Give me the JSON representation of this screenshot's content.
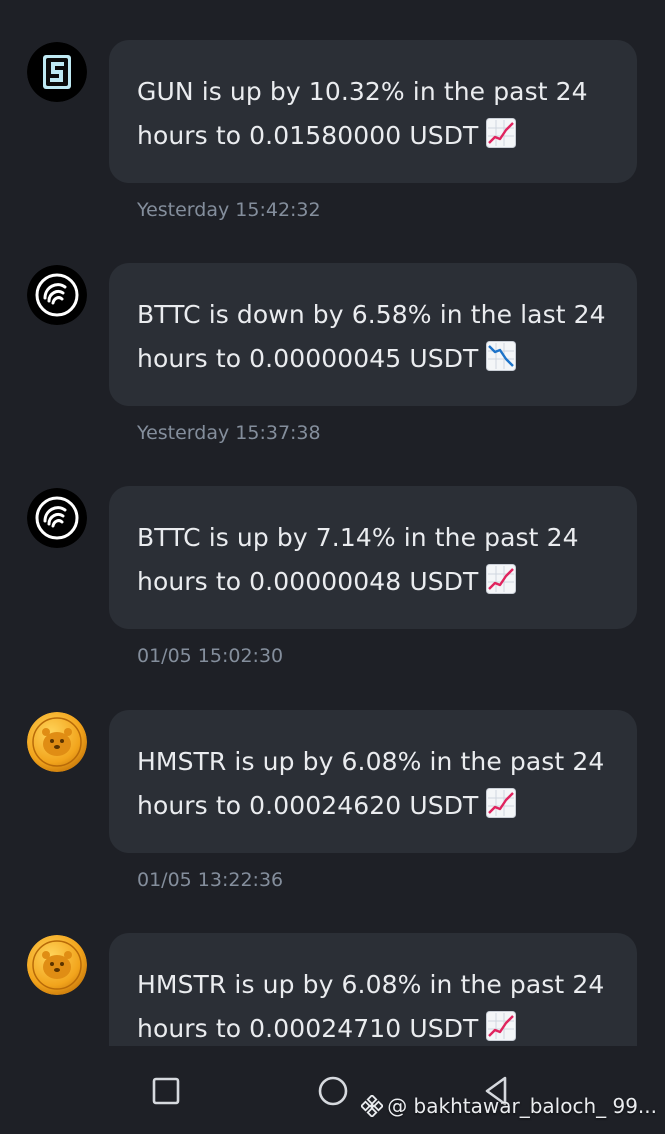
{
  "colors": {
    "background": "#1e2026",
    "bubble": "#2b2f36",
    "text": "#eaecef",
    "timestamp": "#848e9c"
  },
  "messages": [
    {
      "coin": "GUN",
      "avatar_icon": "gun-logo-icon",
      "text": "GUN is up by 10.32% in the past 24 hours to 0.01580000 USDT",
      "trend_icon": "chart-increasing-icon",
      "timestamp": "Yesterday 15:42:32"
    },
    {
      "coin": "BTTC",
      "avatar_icon": "bttc-logo-icon",
      "text": "BTTC is down by 6.58% in the last 24 hours to 0.00000045 USDT",
      "trend_icon": "chart-decreasing-icon",
      "timestamp": "Yesterday 15:37:38"
    },
    {
      "coin": "BTTC",
      "avatar_icon": "bttc-logo-icon",
      "text": "BTTC is up by 7.14% in the past 24 hours to 0.00000048 USDT",
      "trend_icon": "chart-increasing-icon",
      "timestamp": "01/05 15:02:30"
    },
    {
      "coin": "HMSTR",
      "avatar_icon": "hamster-logo-icon",
      "text": "HMSTR is up by 6.08% in the past 24 hours to 0.00024620 USDT",
      "trend_icon": "chart-increasing-icon",
      "timestamp": "01/05 13:22:36"
    },
    {
      "coin": "HMSTR",
      "avatar_icon": "hamster-logo-icon",
      "text": "HMSTR is up by 6.08% in the past 24 hours to 0.00024710 USDT",
      "trend_icon": "chart-increasing-icon",
      "timestamp": ""
    }
  ],
  "navbar": {
    "recents_icon": "square-icon",
    "home_icon": "circle-icon",
    "back_icon": "triangle-back-icon"
  },
  "watermark": {
    "icon": "binance-logo-icon",
    "text": "@ bakhtawar_baloch_ 99..."
  }
}
